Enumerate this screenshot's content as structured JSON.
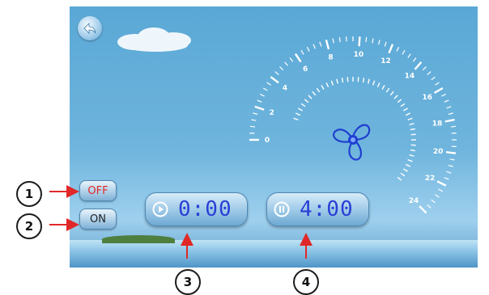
{
  "buttons": {
    "off_label": "OFF",
    "on_label": "ON"
  },
  "timers": {
    "run_time": "0:00",
    "pause_time": "4:00"
  },
  "gauge": {
    "outer_ticks": [
      "0",
      "2",
      "4",
      "6",
      "8",
      "10",
      "12",
      "14",
      "16",
      "18",
      "20",
      "22",
      "24"
    ]
  },
  "callouts": [
    "1",
    "2",
    "3",
    "4"
  ],
  "icons": {
    "back": "back-arrow-icon",
    "play": "play-icon",
    "pause": "pause-icon",
    "fan": "fan-icon",
    "cloud": "cloud-icon"
  },
  "colors": {
    "sky": "#6fb5dd",
    "off_text": "#e02828",
    "timer_text": "#2a3fd6",
    "annotation": "#e02828"
  }
}
